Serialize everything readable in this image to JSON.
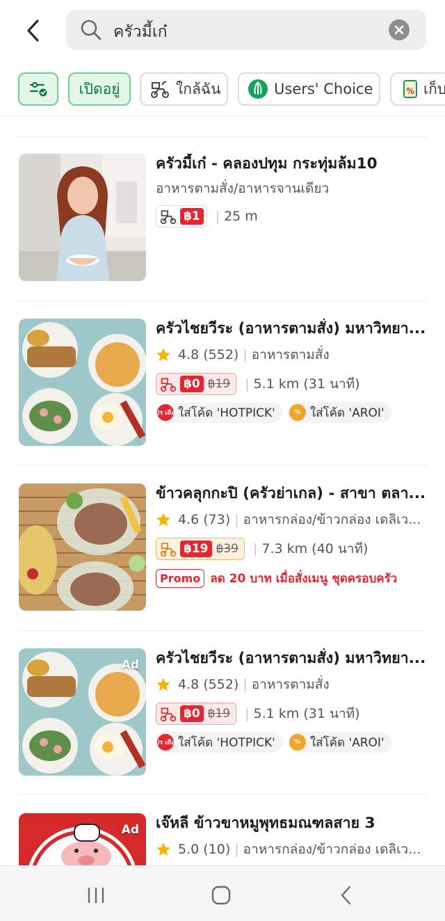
{
  "search": {
    "query": "ครัวมี้เก๋"
  },
  "filters": [
    {
      "label": "",
      "icon": "filter-settings-icon",
      "active": true
    },
    {
      "label": "เปิดอยู่",
      "active": true
    },
    {
      "label": "ใกล้ฉัน",
      "icon": "scooter-icon",
      "active": false
    },
    {
      "label": "Users' Choice",
      "icon": "users-choice-icon",
      "active": false
    },
    {
      "label": "เก็บ",
      "icon": "coupon-icon",
      "active": false
    }
  ],
  "restaurants": [
    {
      "name": "ครัวมี้เก๋ - คลองปทุม กระทุ่มล้ม10",
      "category": "อาหารตามสั่ง/อาหารจานเดียว",
      "delivery_fee": "฿1",
      "distance": "25 m"
    },
    {
      "name": "ครัวไชยวีระ (อาหารตามสั่ง) มหาวิทยา...",
      "rating": "4.8 (552)",
      "category": "อาหารตามสั่ง",
      "delivery_fee": "฿0",
      "original_fee": "฿19",
      "distance": "5.1 km (31 นาที)",
      "tags": [
        "ใส่โค้ด 'HOTPICK'",
        "ใส่โค้ด 'AROI'"
      ],
      "tag_icon_text": "โปร เดือด"
    },
    {
      "name": "ข้าวคลุกกะปิ (ครัวย่าเกล) - สาขา ตลา...",
      "rating": "4.6 (73)",
      "category": "อาหารกล่อง/ข้าวกล่อง เดลิเว...",
      "delivery_fee": "฿19",
      "original_fee": "฿39",
      "distance": "7.3 km (40 นาที)",
      "promo_badge": "Promo",
      "promo_text": "ลด 20 บาท เมื่อสั่งเมนู ชุดครอบครัว"
    },
    {
      "name": "ครัวไชยวีระ (อาหารตามสั่ง) มหาวิทยา...",
      "ad": "Ad",
      "rating": "4.8 (552)",
      "category": "อาหารตามสั่ง",
      "delivery_fee": "฿0",
      "original_fee": "฿19",
      "distance": "5.1 km (31 นาที)",
      "tags": [
        "ใส่โค้ด 'HOTPICK'",
        "ใส่โค้ด 'AROI'"
      ],
      "tag_icon_text": "โปร เดือด"
    },
    {
      "name": "เจ๊หลี ข้าวขาหมูพุทธมณฑลสาย 3",
      "ad": "Ad",
      "rating": "5.0 (10)",
      "category": "อาหารกล่อง/ข้าวกล่อง เดลิเว..."
    }
  ],
  "colors": {
    "accent_green": "#00b14f",
    "promo_red": "#e3262f"
  }
}
